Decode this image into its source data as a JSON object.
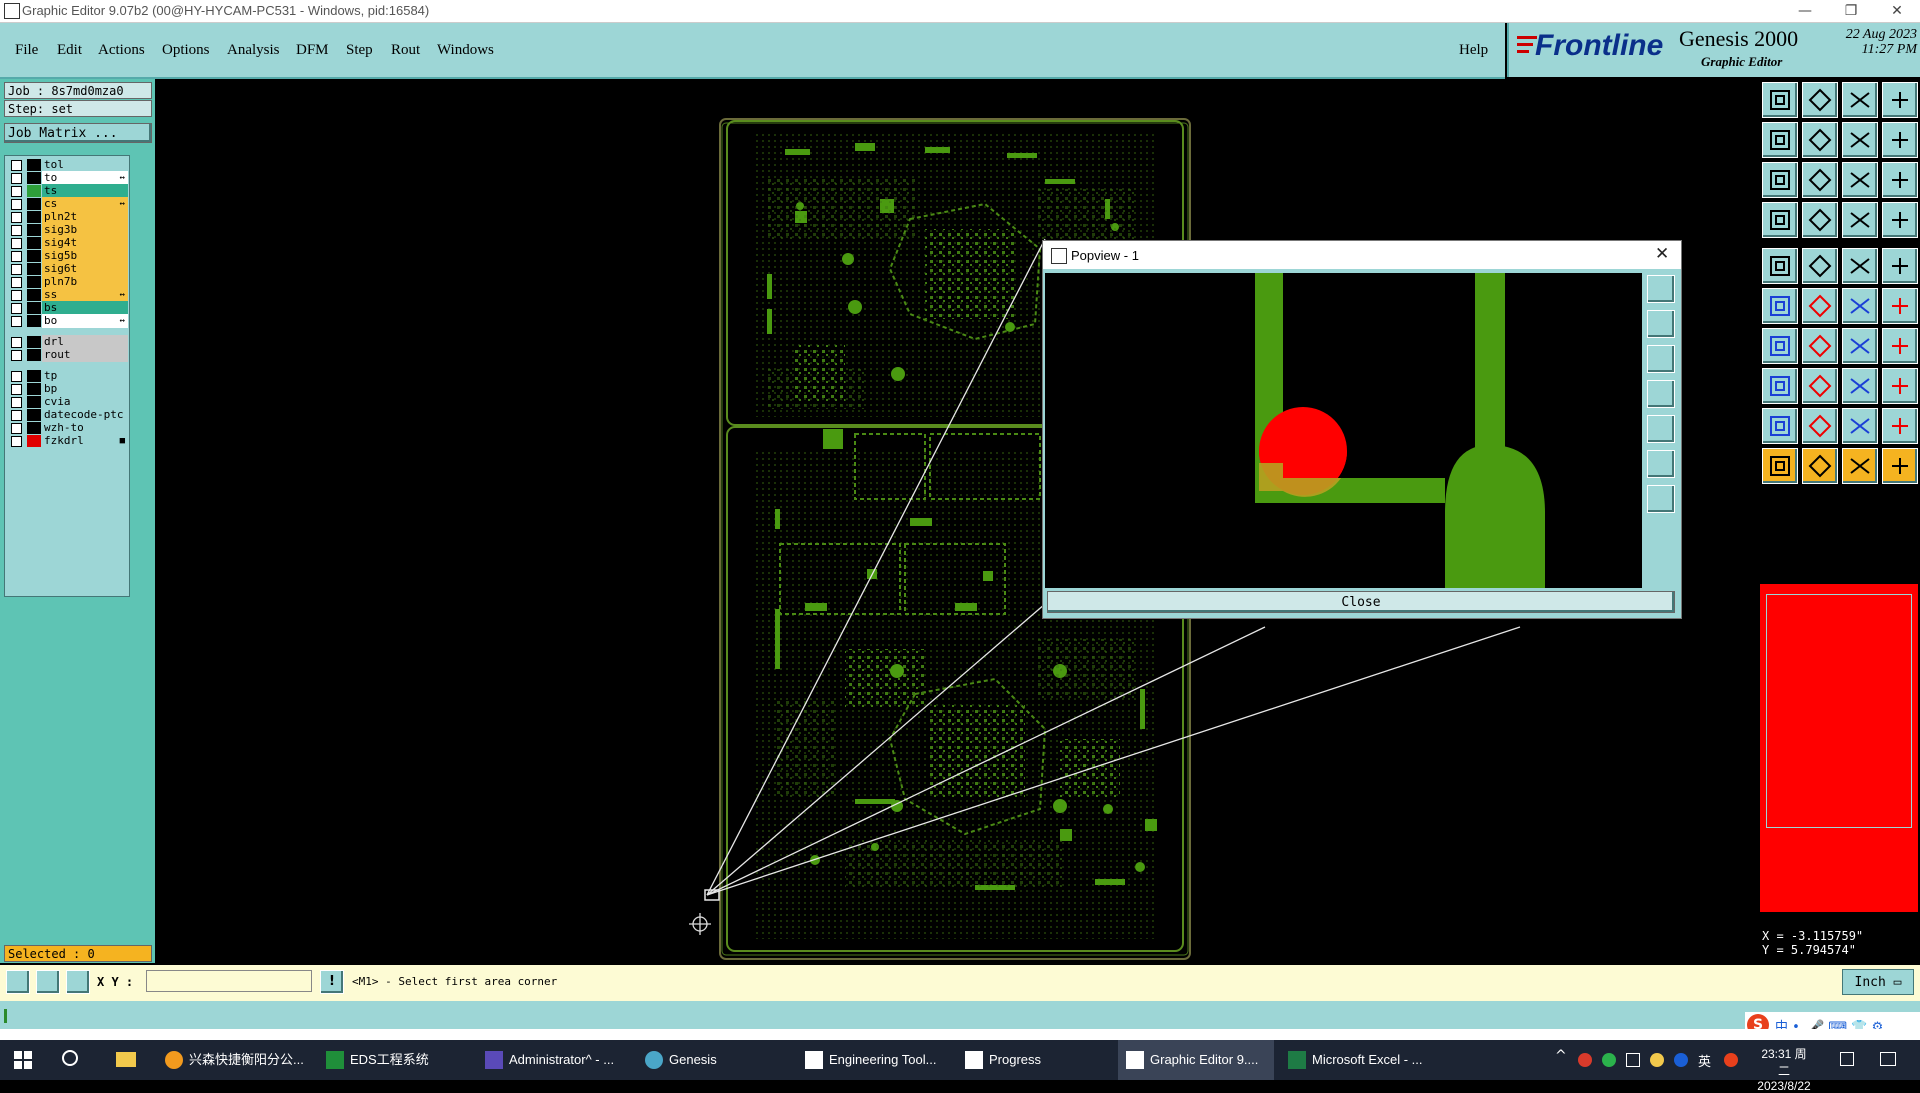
{
  "window": {
    "title": "Graphic Editor 9.07b2 (00@HY-HYCAM-PC531 - Windows, pid:16584)"
  },
  "menu": {
    "file": "File",
    "edit": "Edit",
    "actions": "Actions",
    "options": "Options",
    "analysis": "Analysis",
    "dfm": "DFM",
    "step": "Step",
    "rout": "Rout",
    "windows": "Windows",
    "help": "Help"
  },
  "brand": {
    "logo": "Frontline",
    "product": "Genesis 2000",
    "subtitle": "Graphic Editor",
    "date": "22 Aug 2023",
    "time": "11:27 PM"
  },
  "left": {
    "job": "Job : 8s7md0mza0",
    "step": "Step: set",
    "job_matrix": "Job Matrix ...",
    "selected": "Selected : 0"
  },
  "layers": [
    {
      "name": "tol",
      "bg": "#9dd6d6",
      "color": "#000000",
      "mark": ""
    },
    {
      "name": "to",
      "bg": "#ffffff",
      "color": "#000000",
      "mark": "↔"
    },
    {
      "name": "ts",
      "bg": "#2fae8f",
      "color": "#2e9f3a",
      "mark": ""
    },
    {
      "name": "cs",
      "bg": "#f5c242",
      "color": "#000000",
      "mark": "↔"
    },
    {
      "name": "pln2t",
      "bg": "#f5c242",
      "color": "#000000",
      "mark": ""
    },
    {
      "name": "sig3b",
      "bg": "#f5c242",
      "color": "#000000",
      "mark": ""
    },
    {
      "name": "sig4t",
      "bg": "#f5c242",
      "color": "#000000",
      "mark": ""
    },
    {
      "name": "sig5b",
      "bg": "#f5c242",
      "color": "#000000",
      "mark": ""
    },
    {
      "name": "sig6t",
      "bg": "#f5c242",
      "color": "#000000",
      "mark": ""
    },
    {
      "name": "pln7b",
      "bg": "#f5c242",
      "color": "#000000",
      "mark": ""
    },
    {
      "name": "ss",
      "bg": "#f5c242",
      "color": "#000000",
      "mark": "↔"
    },
    {
      "name": "bs",
      "bg": "#2fae8f",
      "color": "#000000",
      "mark": ""
    },
    {
      "name": "bo",
      "bg": "#ffffff",
      "color": "#000000",
      "mark": "↔"
    },
    {
      "name": "drl",
      "bg": "#c8c8c8",
      "color": "#000000",
      "mark": ""
    },
    {
      "name": "rout",
      "bg": "#c8c8c8",
      "color": "#000000",
      "mark": ""
    },
    {
      "name": "tp",
      "bg": "#9dd6d6",
      "color": "#000000",
      "mark": ""
    },
    {
      "name": "bp",
      "bg": "#9dd6d6",
      "color": "#000000",
      "mark": ""
    },
    {
      "name": "cvia",
      "bg": "#9dd6d6",
      "color": "#000000",
      "mark": ""
    },
    {
      "name": "datecode-ptc",
      "bg": "#9dd6d6",
      "color": "#000000",
      "mark": ""
    },
    {
      "name": "wzh-to",
      "bg": "#9dd6d6",
      "color": "#000000",
      "mark": ""
    },
    {
      "name": "fzkdrl",
      "bg": "#9dd6d6",
      "color": "#e00000",
      "mark": "■"
    }
  ],
  "popview": {
    "title": "Popview - 1",
    "close_label": "Close"
  },
  "coords": {
    "x": "X = -3.115759\"",
    "y": "Y = 5.794574\""
  },
  "status": {
    "xy_label": "X Y :",
    "xy_value": "",
    "message": "<M1> - Select first area corner",
    "units": "Inch"
  },
  "taskbar": {
    "items": [
      "兴森快捷衡阳分公...",
      "EDS工程系统",
      "Administrator^ - ...",
      "Genesis",
      "Engineering Tool...",
      "Progress",
      "Graphic Editor 9....",
      "Microsoft Excel - ..."
    ],
    "clock_time": "23:31 周二",
    "clock_date": "2023/8/22",
    "ime": "英"
  },
  "colors": {
    "panel": "#9dd6d6",
    "accent_green": "#4a9a10",
    "highlight_red": "#ff0000",
    "orange": "#f5b320"
  }
}
